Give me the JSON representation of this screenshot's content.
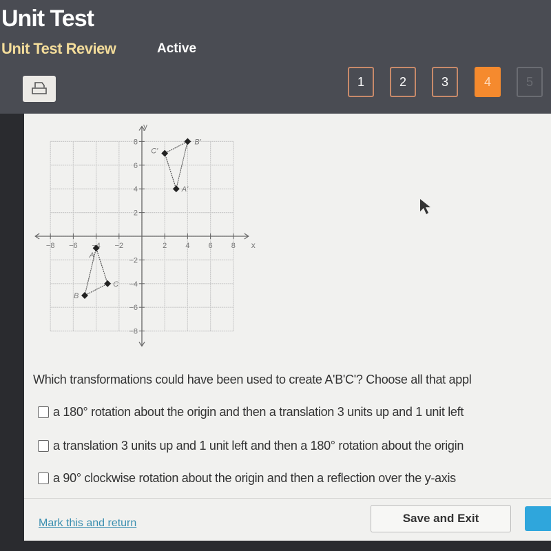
{
  "header": {
    "title": "Unit Test",
    "subtitle": "Unit Test Review",
    "status": "Active",
    "print_icon": "printer-icon",
    "question_nav": [
      {
        "label": "1",
        "state": "answered"
      },
      {
        "label": "2",
        "state": "answered"
      },
      {
        "label": "3",
        "state": "answered"
      },
      {
        "label": "4",
        "state": "current"
      },
      {
        "label": "5",
        "state": "disabled"
      }
    ]
  },
  "graph": {
    "x_label": "x",
    "y_label": "y",
    "x_ticks": [
      -8,
      -6,
      -4,
      -2,
      2,
      4,
      6,
      8
    ],
    "y_ticks": [
      8,
      6,
      4,
      2,
      -2,
      -4,
      -6,
      -8
    ],
    "range": [
      -8,
      8
    ],
    "original": [
      {
        "label": "A",
        "x": -4,
        "y": -1
      },
      {
        "label": "B",
        "x": -5,
        "y": -5
      },
      {
        "label": "C",
        "x": -3,
        "y": -4
      }
    ],
    "image": [
      {
        "label": "A'",
        "x": 3,
        "y": 4
      },
      {
        "label": "B'",
        "x": 4,
        "y": 8
      },
      {
        "label": "C'",
        "x": 2,
        "y": 7
      }
    ]
  },
  "question": {
    "prompt": "Which transformations could have been used to create A'B'C'? Choose all that appl",
    "options": [
      "a 180° rotation about the origin and then a translation 3 units up and 1 unit left",
      "a translation 3 units up and 1 unit left and then a 180° rotation about the origin",
      "a 90° clockwise rotation about the origin and then a reflection over the y-axis"
    ]
  },
  "footer": {
    "mark_link": "Mark this and return",
    "save_exit": "Save and Exit"
  },
  "colors": {
    "accent": "#f58a2e",
    "link": "#3b8fb0",
    "primary_button": "#2fa6dc"
  }
}
